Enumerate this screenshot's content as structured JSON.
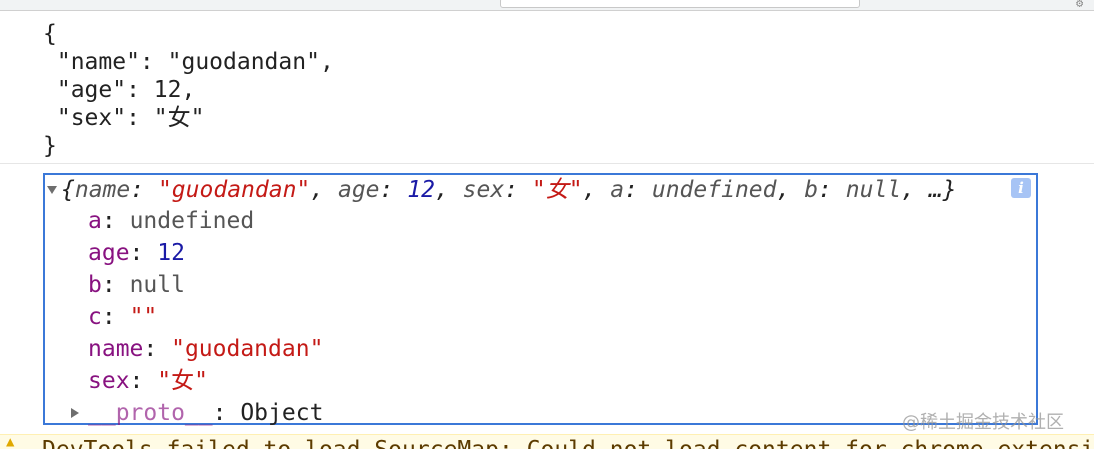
{
  "json_lines": [
    "{",
    " \"name\": \"guodandan\",",
    " \"age\": 12,",
    " \"sex\": \"女\"",
    "}"
  ],
  "summary": {
    "open": "{",
    "k_name": "name",
    "sep1": ": ",
    "v_name": "\"guodandan\"",
    "c1": ", ",
    "k_age": "age",
    "sep2": ": ",
    "v_age": "12",
    "c2": ", ",
    "k_sex": "sex",
    "sep3": ": ",
    "v_sex": "\"女\"",
    "c3": ", ",
    "k_a": "a",
    "sep4": ": ",
    "v_a": "undefined",
    "c4": ", ",
    "k_b": "b",
    "sep5": ": ",
    "v_b": "null",
    "tail": ", …}"
  },
  "info_badge": "i",
  "properties": [
    {
      "key": "a",
      "value": "undefined"
    },
    {
      "key": "age",
      "value": "12"
    },
    {
      "key": "b",
      "value": "null"
    },
    {
      "key": "c",
      "value": "\"\""
    },
    {
      "key": "name",
      "value": "\"guodandan\""
    },
    {
      "key": "sex",
      "value": "\"女\""
    }
  ],
  "colon": ": ",
  "proto": {
    "key": "__proto__",
    "value": "Object"
  },
  "warning_text": "DevTools failed to load SourceMap: Could not load content for chrome-extension",
  "watermark": "@稀土掘金技术社区"
}
